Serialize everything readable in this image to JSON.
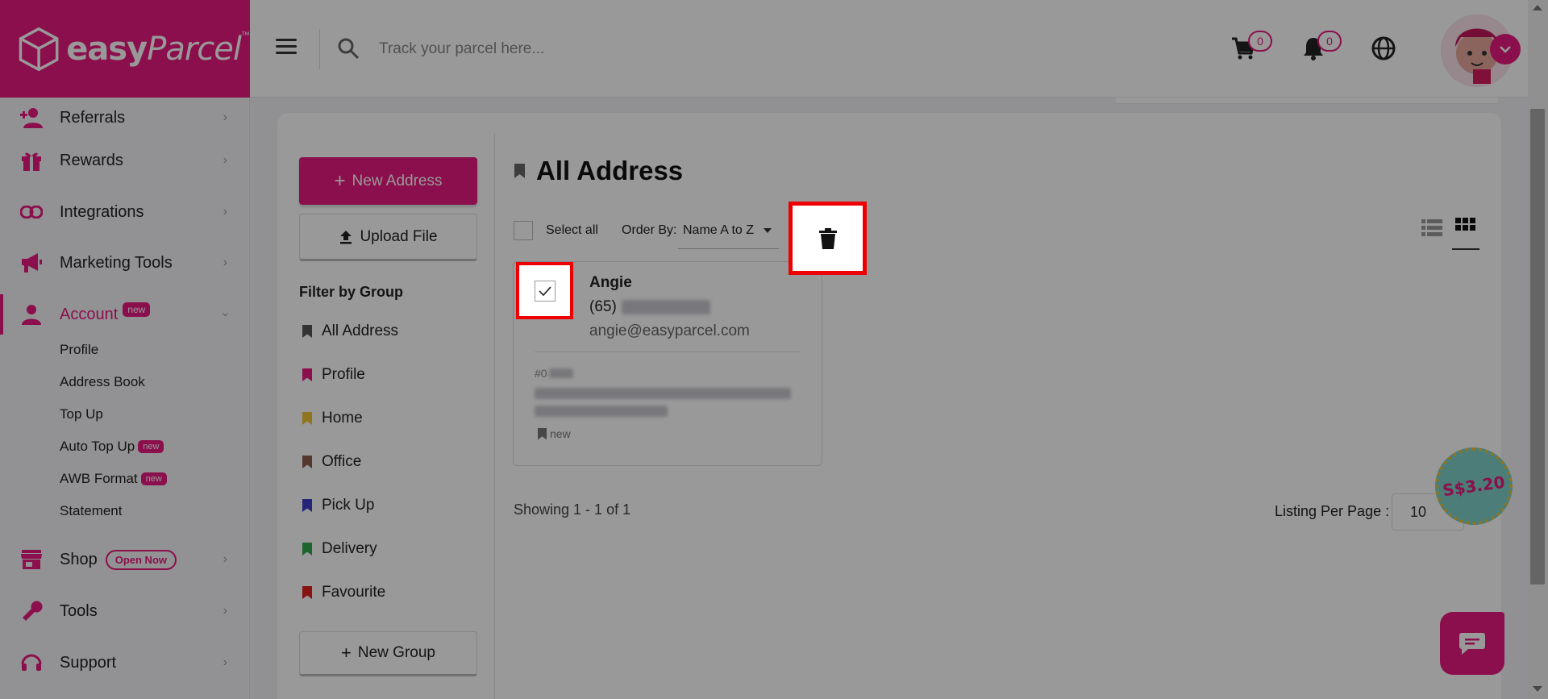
{
  "brand": {
    "logo_text_bold": "easy",
    "logo_text_italic": "Parcel",
    "trademark": "™",
    "color": "#e8197f"
  },
  "topbar": {
    "search_placeholder": "Track your parcel here...",
    "cart_count": "0",
    "notification_count": "0"
  },
  "sidebar": {
    "items": [
      {
        "label": "Referrals",
        "icon": "referral-icon"
      },
      {
        "label": "Rewards",
        "icon": "gift-icon"
      },
      {
        "label": "Integrations",
        "icon": "link-icon"
      },
      {
        "label": "Marketing Tools",
        "icon": "megaphone-icon"
      },
      {
        "label": "Account",
        "icon": "person-icon",
        "badge": "new"
      },
      {
        "label": "Shop",
        "icon": "store-icon",
        "badge": "Open Now"
      },
      {
        "label": "Tools",
        "icon": "wrench-icon"
      },
      {
        "label": "Support",
        "icon": "headset-icon"
      }
    ],
    "subitems": [
      {
        "label": "Profile"
      },
      {
        "label": "Address Book"
      },
      {
        "label": "Top Up"
      },
      {
        "label": "Auto Top Up",
        "badge": "new"
      },
      {
        "label": "AWB Format",
        "badge": "new"
      },
      {
        "label": "Statement"
      }
    ]
  },
  "left_panel": {
    "new_address_label": "New Address",
    "upload_file_label": "Upload File",
    "filter_title": "Filter by Group",
    "groups": [
      {
        "label": "All Address",
        "color": "#555555"
      },
      {
        "label": "Profile",
        "color": "#e8197f"
      },
      {
        "label": "Home",
        "color": "#f1c232"
      },
      {
        "label": "Office",
        "color": "#8d5e4e"
      },
      {
        "label": "Pick Up",
        "color": "#3c3cc8"
      },
      {
        "label": "Delivery",
        "color": "#2fa84f"
      },
      {
        "label": "Favourite",
        "color": "#e01e1e"
      }
    ],
    "new_group_label": "New Group"
  },
  "main": {
    "title": "All Address",
    "select_all_label": "Select all",
    "order_by_label": "Order By:",
    "order_by_value": "Name A to Z",
    "card": {
      "name": "Angie",
      "phone_prefix": "(65)",
      "email": "angie@easyparcel.com",
      "code_prefix": "#0",
      "tag": "new"
    },
    "showing_text": "Showing 1 - 1 of 1",
    "listing_per_page_label": "Listing Per Page :",
    "listing_per_page_value": "10"
  },
  "promo": {
    "price": "S$3.20"
  }
}
